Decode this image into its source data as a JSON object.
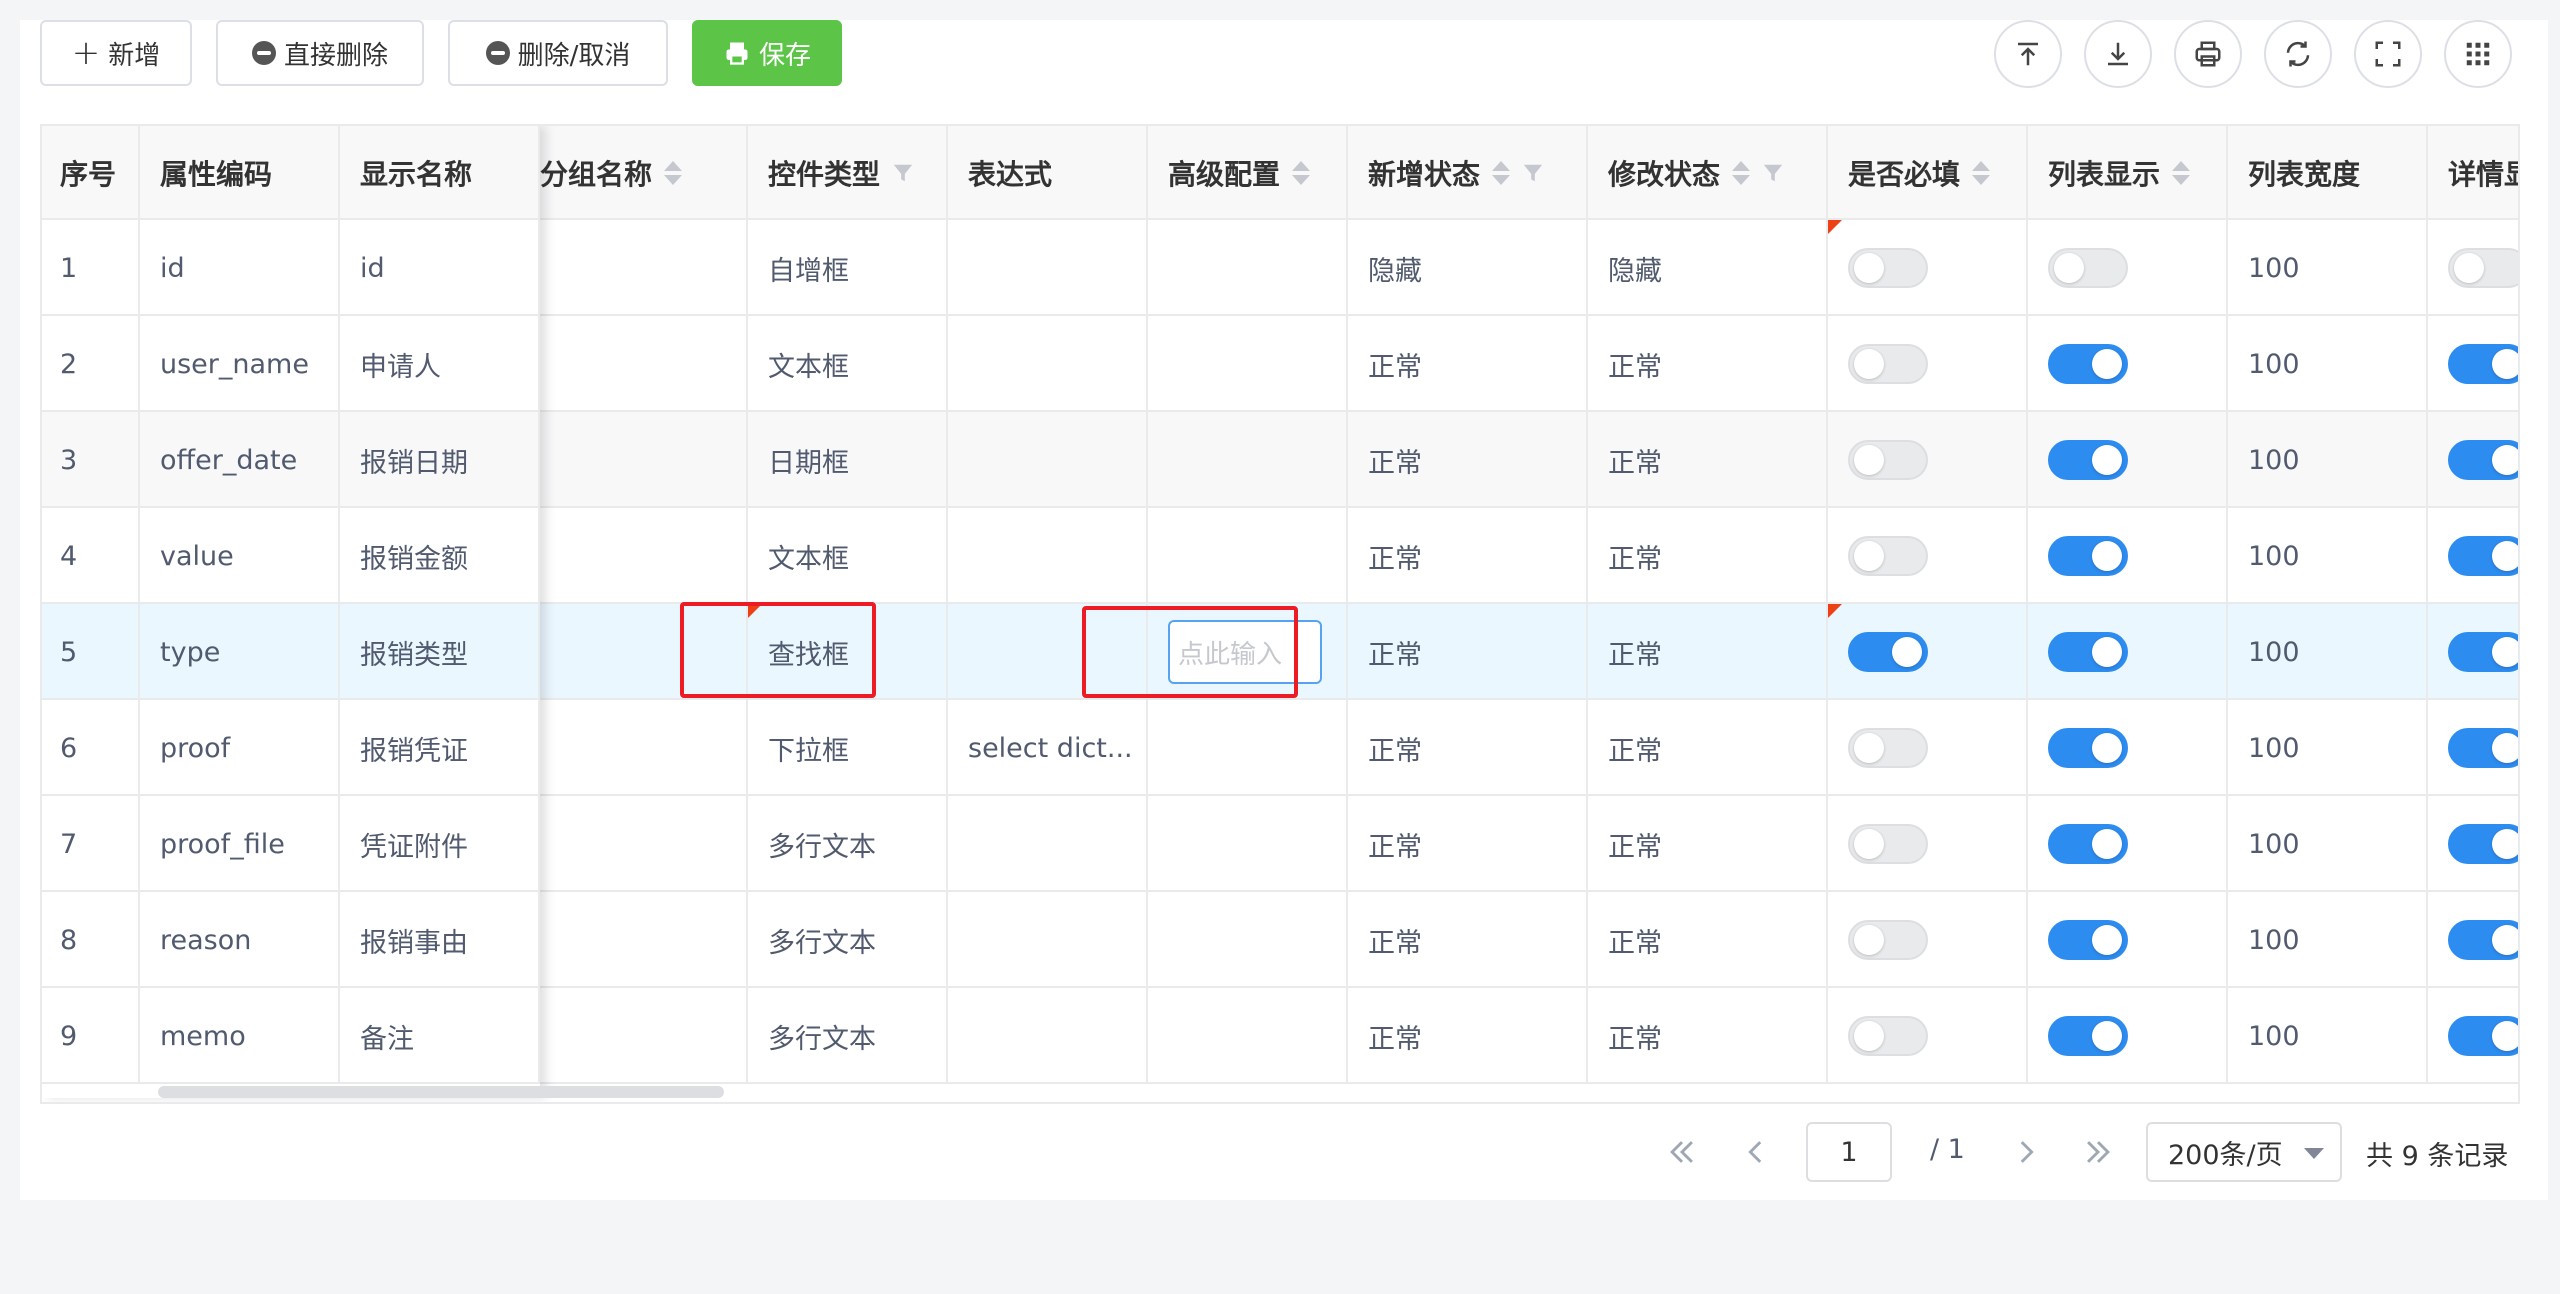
{
  "toolbar": {
    "add": "新增",
    "delete_direct": "直接删除",
    "delete_cancel": "删除/取消",
    "save": "保存"
  },
  "columns": [
    "序号",
    "属性编码",
    "显示名称",
    "分组名称",
    "控件类型",
    "表达式",
    "高级配置",
    "新增状态",
    "修改状态",
    "是否必填",
    "列表显示",
    "列表宽度",
    "详情显示"
  ],
  "rows": [
    {
      "no": "1",
      "code": "id",
      "name": "id",
      "control": "自增框",
      "expr": "",
      "add_state": "隐藏",
      "edit_state": "隐藏",
      "required": false,
      "list_show": false,
      "width": "100",
      "detail_show": false
    },
    {
      "no": "2",
      "code": "user_name",
      "name": "申请人",
      "control": "文本框",
      "expr": "",
      "add_state": "正常",
      "edit_state": "正常",
      "required": false,
      "list_show": true,
      "width": "100",
      "detail_show": true
    },
    {
      "no": "3",
      "code": "offer_date",
      "name": "报销日期",
      "control": "日期框",
      "expr": "",
      "add_state": "正常",
      "edit_state": "正常",
      "required": false,
      "list_show": true,
      "width": "100",
      "detail_show": true
    },
    {
      "no": "4",
      "code": "value",
      "name": "报销金额",
      "control": "文本框",
      "expr": "",
      "add_state": "正常",
      "edit_state": "正常",
      "required": false,
      "list_show": true,
      "width": "100",
      "detail_show": true
    },
    {
      "no": "5",
      "code": "type",
      "name": "报销类型",
      "control": "查找框",
      "expr": "",
      "add_state": "正常",
      "edit_state": "正常",
      "required": true,
      "list_show": true,
      "width": "100",
      "detail_show": true
    },
    {
      "no": "6",
      "code": "proof",
      "name": "报销凭证",
      "control": "下拉框",
      "expr": "select dict...",
      "add_state": "正常",
      "edit_state": "正常",
      "required": false,
      "list_show": true,
      "width": "100",
      "detail_show": true
    },
    {
      "no": "7",
      "code": "proof_file",
      "name": "凭证附件",
      "control": "多行文本",
      "expr": "",
      "add_state": "正常",
      "edit_state": "正常",
      "required": false,
      "list_show": true,
      "width": "100",
      "detail_show": true
    },
    {
      "no": "8",
      "code": "reason",
      "name": "报销事由",
      "control": "多行文本",
      "expr": "",
      "add_state": "正常",
      "edit_state": "正常",
      "required": false,
      "list_show": true,
      "width": "100",
      "detail_show": true
    },
    {
      "no": "9",
      "code": "memo",
      "name": "备注",
      "control": "多行文本",
      "expr": "",
      "add_state": "正常",
      "edit_state": "正常",
      "required": false,
      "list_show": true,
      "width": "100",
      "detail_show": true
    }
  ],
  "advanced_input_placeholder": "点此输入",
  "pager": {
    "current": "1",
    "total_pages": "/ 1",
    "page_size": "200条/页",
    "total": "共 9 条记录"
  },
  "colors": {
    "primary": "#2d8cf0",
    "save": "#5cc447",
    "highlight": "#ed1c24"
  },
  "icons": [
    "plus-icon",
    "minus-circle-icon",
    "printer-icon",
    "to-top-icon",
    "download-icon",
    "print-icon",
    "refresh-icon",
    "fullscreen-icon",
    "grid-icon",
    "sort-icon",
    "filter-icon",
    "first-page-icon",
    "prev-page-icon",
    "next-page-icon",
    "last-page-icon",
    "chevron-down-icon"
  ]
}
